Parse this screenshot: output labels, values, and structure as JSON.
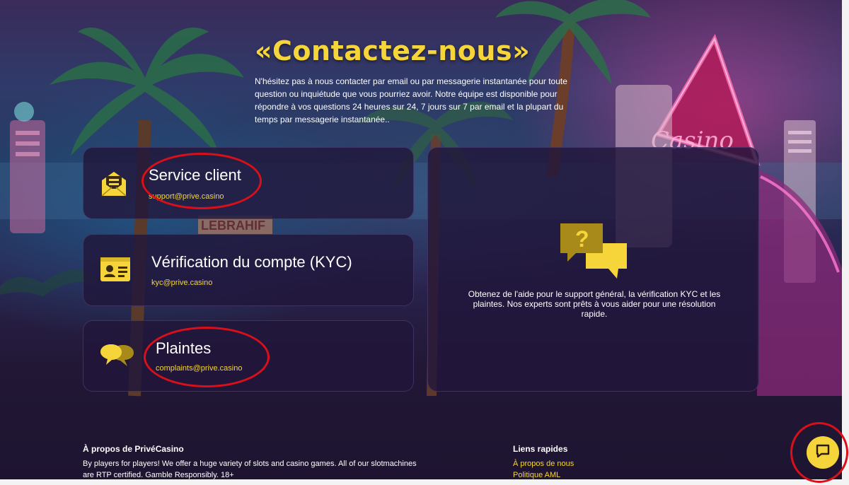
{
  "page": {
    "title": "«Contactez-nous»",
    "intro": "N'hésitez pas à nous contacter par email ou par messagerie instantanée pour toute question ou inquiétude que vous pourriez avoir. Notre équipe est disponible pour répondre à vos questions 24 heures sur 24, 7 jours sur 7 par email et la plupart du temps par messagerie instantanée.."
  },
  "contacts": [
    {
      "title": "Service client",
      "email": "support@prive.casino",
      "icon": "mail-icon"
    },
    {
      "title": "Vérification du compte (KYC)",
      "email": "kyc@prive.casino",
      "icon": "id-card-icon"
    },
    {
      "title": "Plaintes",
      "email": "complaints@prive.casino",
      "icon": "chat-bubbles-icon"
    }
  ],
  "help_card": {
    "icon": "question-bubbles-icon",
    "text": "Obtenez de l'aide pour le support général, la vérification KYC et les plaintes. Nos experts sont prêts à vous aider pour une résolution rapide."
  },
  "footer": {
    "about_heading": "À propos de PrivéCasino",
    "about_text": "By players for players! We offer a huge variety of slots and casino games. All of our slotmachines are RTP certified. Gamble Responsibly. 18+",
    "links_heading": "Liens rapides",
    "links": [
      "À propos de nous",
      "Politique AML"
    ]
  },
  "background_sign": "LEBRAHIF",
  "colors": {
    "accent": "#f5d53a",
    "card_bg": "#21163a",
    "annotation": "#d9101a"
  },
  "chat_button_icon": "chat-icon"
}
